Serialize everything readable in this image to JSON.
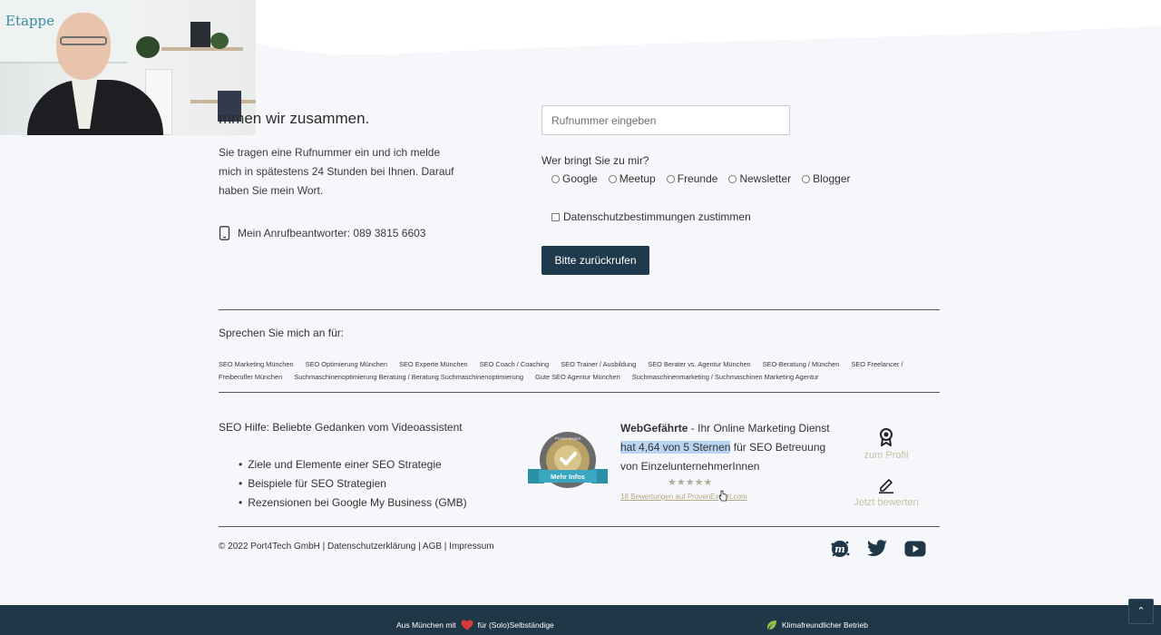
{
  "video": {
    "board_text": "Etappe"
  },
  "contact": {
    "title": "mmen wir zusammen.",
    "text": "Sie tragen eine Rufnummer ein und ich melde mich in spätestens 24 Stunden bei Ihnen. Darauf haben Sie mein Wort.",
    "phone_line": "Mein Anrufbeantworter: 089 3815 6603"
  },
  "form": {
    "phone_placeholder": "Rufnummer eingeben",
    "phone_value": "",
    "source_label": "Wer bringt Sie zu mir?",
    "source_options": [
      "Google",
      "Meetup",
      "Freunde",
      "Newsletter",
      "Blogger"
    ],
    "privacy_label": "Datenschutzbestimmungen zustimmen",
    "submit_label": "Bitte zurückrufen"
  },
  "speak": {
    "title": "Sprechen Sie mich an für:",
    "tags": [
      "SEO Marketing München",
      "SEO Optimierung München",
      "SEO Experte München",
      "SEO Coach / Coaching",
      "SEO Trainer / Ausbildung",
      "SEO Berater vs. Agentur München",
      "SEO-Beratung / München",
      "SEO Freelancer / Freiberufler München",
      "Suchmaschinenoptimierung Beratung / Beratung Suchmaschinenoptimierung",
      "Gute SEO Agentur München",
      "Suchmaschinenmarketing / Suchmaschinen Marketing Agentur"
    ]
  },
  "help": {
    "title": "SEO Hilfe: Beliebte Gedanken vom Videoassistent",
    "items": [
      "Ziele und Elemente einer SEO Strategie",
      "Beispiele für SEO Strategien",
      "Rezensionen bei Google My Business (GMB)"
    ]
  },
  "review": {
    "badge_label": "Mehr Infos",
    "badge_ring": "Proven Expert",
    "brand": "WebGefährte",
    "brand_suffix": " - Ihr Online Marketing Dienst",
    "highlight": "hat 4,64 von 5 Sternen",
    "rest": " für SEO Betreuung von EinzelunternehmerInnen",
    "stars": "★★★★★",
    "link": "18 Bewertungen auf ProvenExpert.com",
    "profile_label": "zum Profil",
    "rate_label": "Jetzt bewerten"
  },
  "footer": {
    "copyright": "© 2022 Port4Tech GmbH | Datenschutzerklärung | AGB | Impressum",
    "left_text_1": "Aus München mit",
    "left_text_2": "für (Solo)Selbständige",
    "right_text": "Klimafreundlicher Betrieb",
    "scroll_top": "⌃"
  },
  "colors": {
    "accent": "#1f3a4d",
    "footer_bg": "#1f3746",
    "link_gold": "#c9c2a4",
    "highlight": "#b9d4f0"
  }
}
